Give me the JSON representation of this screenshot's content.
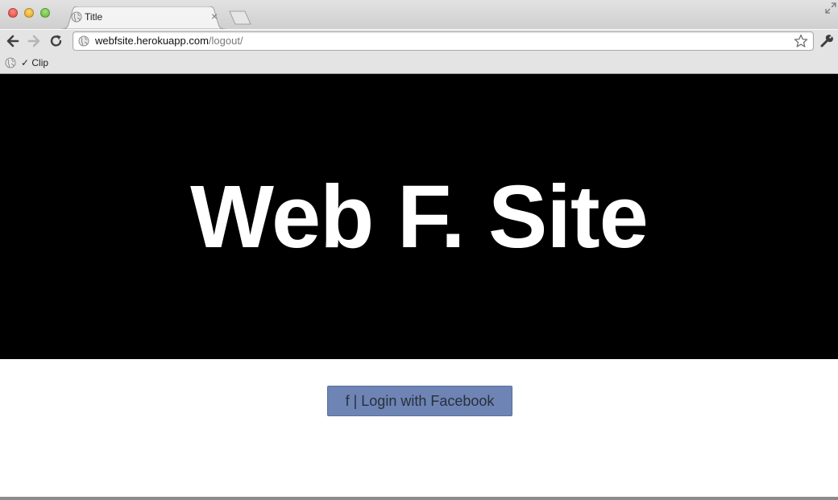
{
  "browser": {
    "tab": {
      "title": "Title",
      "close_glyph": "×"
    },
    "omnibox": {
      "url_host": "webfsite.herokuapp.com",
      "url_path": "/logout/"
    },
    "bookmarks": [
      {
        "label": "✓ Clip"
      }
    ],
    "icons": {
      "back": "back-arrow-icon",
      "forward": "forward-arrow-icon",
      "reload": "reload-icon",
      "star": "star-icon",
      "wrench": "wrench-icon",
      "globe": "globe-icon",
      "fullscreen": "fullscreen-icon"
    }
  },
  "page": {
    "hero_title": "Web F. Site",
    "login_button_label": "f | Login with Facebook"
  },
  "colors": {
    "hero_background": "#000000",
    "hero_text": "#ffffff",
    "facebook_button": "#6d84b4"
  }
}
